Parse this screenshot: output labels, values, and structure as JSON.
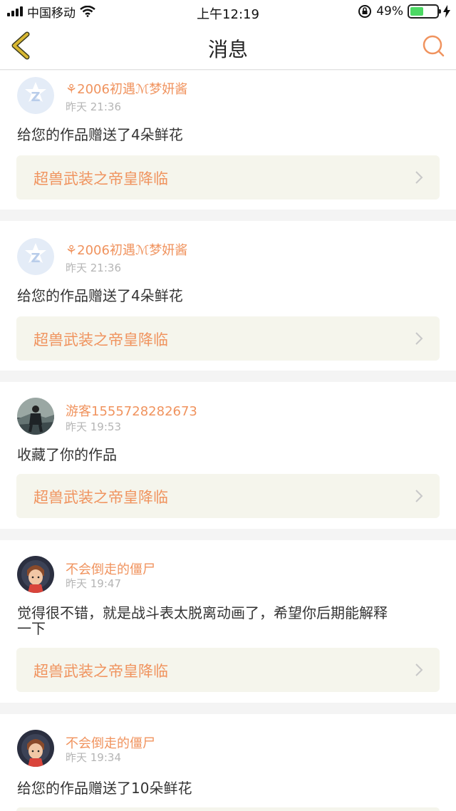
{
  "status_bar": {
    "carrier": "中国移动",
    "time": "上午12:19",
    "battery": "49%",
    "battery_level": 0.49
  },
  "nav": {
    "title": "消息",
    "back_icon": "chevron-left-icon",
    "search_icon": "search-icon"
  },
  "colors": {
    "accent": "#f0935e",
    "back_icon": "#c9a227",
    "link_bg": "#f5f5ec"
  },
  "messages": [
    {
      "username": "⚘2006初遇ℳ梦妍酱",
      "time": "昨天 21:36",
      "text": "给您的作品赠送了4朵鲜花",
      "work": "超兽武装之帝皇降临",
      "avatar": "qq-default-avatar"
    },
    {
      "username": "⚘2006初遇ℳ梦妍酱",
      "time": "昨天 21:36",
      "text": "给您的作品赠送了4朵鲜花",
      "work": "超兽武装之帝皇降临",
      "avatar": "qq-default-avatar"
    },
    {
      "username": "游客1555728282673",
      "time": "昨天 19:53",
      "text": "收藏了你的作品",
      "work": "超兽武装之帝皇降临",
      "avatar": "photo-avatar"
    },
    {
      "username": "不会倒走的僵尸",
      "time": "昨天 19:47",
      "text": "觉得很不错，就是战斗表太脱离动画了，希望你后期能解释一下",
      "text_line1": "觉得很不错，就是战斗表太脱离动画了，希望你后期能解释",
      "text_line2": "一下",
      "work": "超兽武装之帝皇降临",
      "avatar": "cartoon-avatar"
    },
    {
      "username": "不会倒走的僵尸",
      "time": "昨天 19:34",
      "text": "给您的作品赠送了10朵鲜花",
      "work": "",
      "avatar": "cartoon-avatar"
    }
  ]
}
